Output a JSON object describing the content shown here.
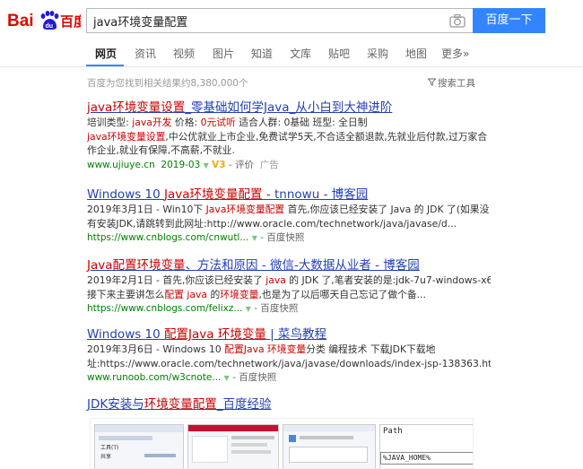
{
  "search": {
    "query": "java环境变量配置",
    "button": "百度一下"
  },
  "tabs": [
    "网页",
    "资讯",
    "视频",
    "图片",
    "知道",
    "文库",
    "贴吧",
    "采购",
    "地图",
    "更多»"
  ],
  "result_count": "百度为您找到相关结果约8,380,000个",
  "tools_label": "搜索工具",
  "results": [
    {
      "title_parts": [
        "java环境变量设置",
        "_零基础如何学Java_从小白到大神进阶"
      ],
      "lines": [
        [
          "培训类型: ",
          "java开发",
          "   价格: ",
          "0元试听",
          "   适合人群: 0基础   班型: 全日制"
        ],
        [
          "java环境变量设置",
          ",中公优就业上市企业,免费试学5天,不合适全额退款,先就业后付款,过万家合"
        ],
        [
          "作企业,就业有保障,不高薪,不就业."
        ]
      ],
      "url": "www.ujiuye.cn",
      "date": "2019-03",
      "v_badge": "V3",
      "eval": "评价",
      "ad": "广告"
    },
    {
      "title_parts": [
        "Windows 10 ",
        "Java环境变量配置",
        " - tnnowu - 博客园"
      ],
      "lines": [
        [
          "2019年3月1日 - Win10下 ",
          "Java环境变量配置",
          " 首先,你应该已经安装了 Java 的 JDK 了(如果没"
        ],
        [
          "有安装JDK,请跳转到此网址:http://www.oracle.com/technetwork/java/javase/d..."
        ]
      ],
      "url": "https://www.cnblogs.com/cnwutl...",
      "snapshot": "百度快照"
    },
    {
      "title_parts": [
        "Java配置环境变量",
        "、方法和原因 - 微信-大数据从业者 - 博客园"
      ],
      "lines": [
        [
          "2019年2月1日 - 首先,你应该已经安装了 ",
          "java",
          " 的 JDK 了,笔者安装的是:jdk-7u7-windows-x64"
        ],
        [
          "接下来主要讲怎么",
          "配置 java",
          " 的",
          "环境变量",
          ",也是为了以后哪天自己忘记了做个备..."
        ]
      ],
      "url": "https://www.cnblogs.com/felixz...",
      "snapshot": "百度快照"
    },
    {
      "title_parts": [
        "Windows 10 ",
        "配置Java 环境变量",
        " | 菜鸟教程"
      ],
      "lines": [
        [
          "2019年3月6日 - Windows 10 ",
          "配置Java 环境变量",
          "分类 编程技术 下载JDK下载地"
        ],
        [
          "址:https://www.oracle.com/technetwork/java/javase/downloads/index-jsp-138363.html..."
        ]
      ],
      "url": "www.runoob.com/w3cnote...",
      "snapshot": "百度快照"
    },
    {
      "title_parts": [
        "JDK安装与",
        "环境变量配置",
        "_百度经验"
      ]
    }
  ],
  "thumbs": {
    "thumb1_lines": [
      "工具(T)",
      "共享"
    ],
    "thumb4_lines": [
      "Path",
      "%JAVA_HOME%"
    ]
  }
}
